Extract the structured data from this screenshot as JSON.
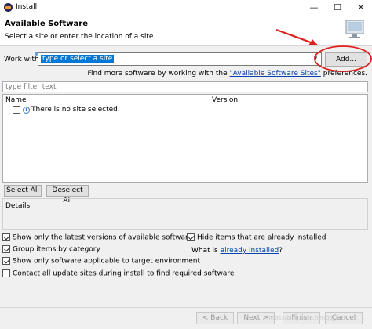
{
  "window": {
    "title": "Install",
    "minimize": "—",
    "maximize": "☐",
    "close": "✕"
  },
  "header": {
    "title": "Available Software",
    "subtitle": "Select a site or enter the location of a site."
  },
  "work_with": {
    "label": "Work with:",
    "value": "type or select a site",
    "add_label": "Add...",
    "find_prefix": "Find more software by working with the ",
    "find_link": "\"Available Software Sites\"",
    "find_suffix": " preferences."
  },
  "filter": {
    "placeholder": "type filter text"
  },
  "table": {
    "columns": [
      "Name",
      "Version"
    ],
    "rows": [
      {
        "checked": false,
        "text": "There is no site selected."
      }
    ]
  },
  "buttons": {
    "select_all": "Select All",
    "deselect_all": "Deselect All"
  },
  "details": {
    "label": "Details"
  },
  "options": {
    "latest_versions": {
      "label": "Show only the latest versions of available software",
      "checked": true
    },
    "hide_installed": {
      "label": "Hide items that are already installed",
      "checked": true
    },
    "group_by_category": {
      "label": "Group items by category",
      "checked": true
    },
    "what_is_prefix": "What is ",
    "what_is_link": "already installed",
    "what_is_suffix": "?",
    "applicable_only": {
      "label": "Show only software applicable to target environment",
      "checked": true
    },
    "contact_sites": {
      "label": "Contact all update sites during install to find required software",
      "checked": false
    }
  },
  "footer": {
    "back": "< Back",
    "next": "Next >",
    "finish": "Finish",
    "cancel": "Cancel"
  },
  "watermark": "https://blog.csdn.net/qq_44..."
}
